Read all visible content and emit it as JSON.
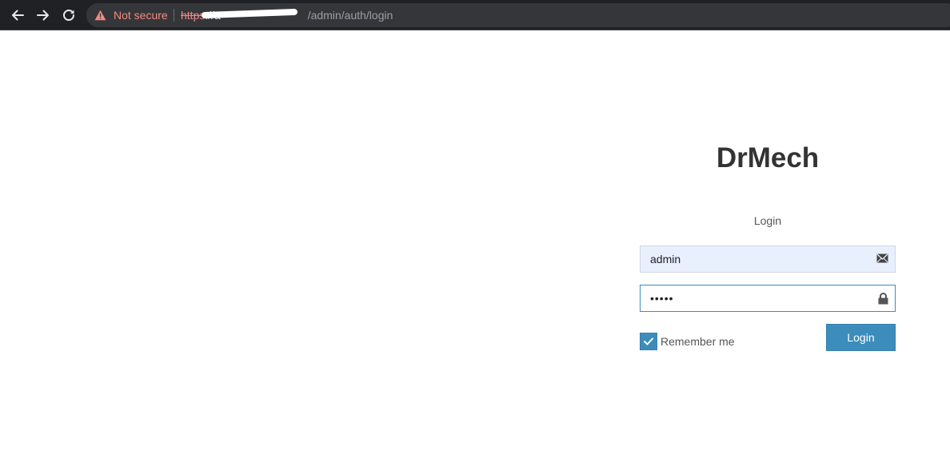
{
  "browser": {
    "security_label": "Not secure",
    "url": {
      "scheme": "https",
      "separator": "://",
      "host": "a",
      "host_redacted": true,
      "path": "/admin/auth/login"
    }
  },
  "login": {
    "brand": "DrMech",
    "subtitle": "Login",
    "username_value": "admin",
    "password_masked": "•••••",
    "remember_label": "Remember me",
    "remember_checked": true,
    "submit_label": "Login"
  },
  "colors": {
    "primary": "#3c8dbc",
    "autofill": "#e8f0fe",
    "not_secure": "#f28b82"
  },
  "icons": {
    "username": "envelope-icon",
    "password": "lock-icon"
  }
}
